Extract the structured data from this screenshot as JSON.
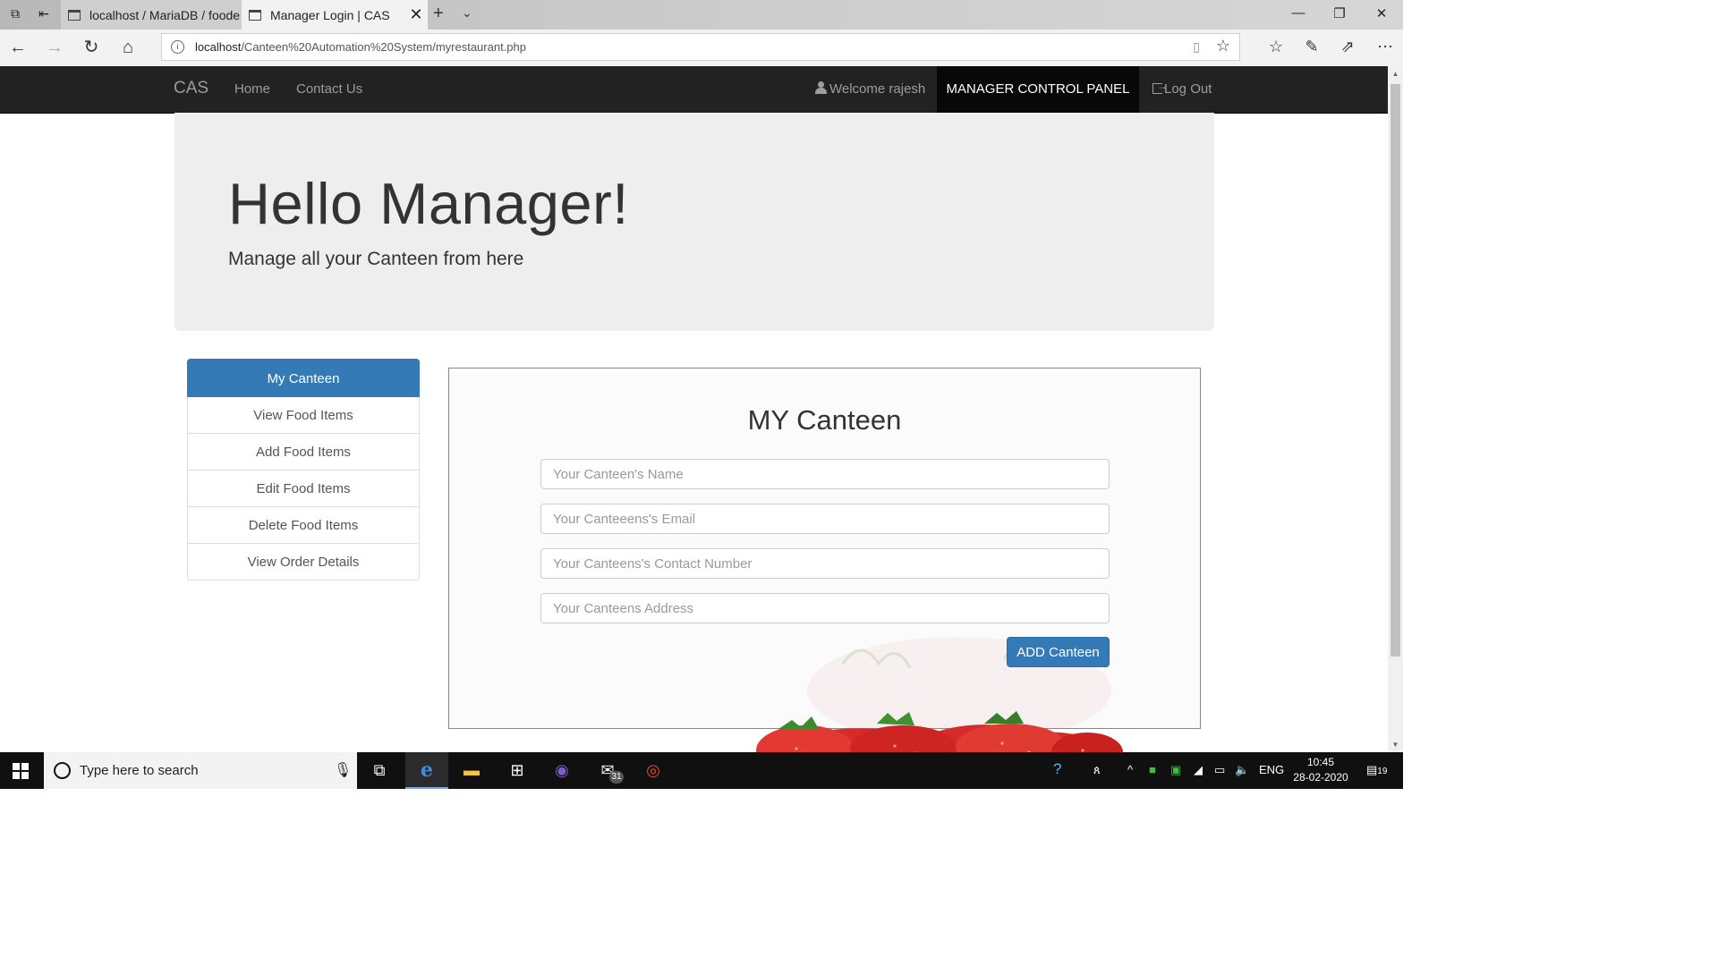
{
  "browser": {
    "tabs": [
      {
        "label": "localhost / MariaDB / foode"
      },
      {
        "label": "Manager Login | CAS"
      }
    ],
    "url_host": "localhost",
    "url_path": "/Canteen%20Automation%20System/myrestaurant.php"
  },
  "navbar": {
    "brand": "CAS",
    "links": [
      "Home",
      "Contact Us"
    ],
    "welcome": "Welcome rajesh",
    "control_panel": "MANAGER CONTROL PANEL",
    "logout": "Log Out"
  },
  "jumbotron": {
    "title": "Hello Manager!",
    "subtitle": "Manage all your Canteen from here"
  },
  "sidebar": {
    "items": [
      {
        "label": "My Canteen",
        "active": true
      },
      {
        "label": "View Food Items"
      },
      {
        "label": "Add Food Items"
      },
      {
        "label": "Edit Food Items"
      },
      {
        "label": "Delete Food Items"
      },
      {
        "label": "View Order Details"
      }
    ]
  },
  "form": {
    "title": "MY Canteen",
    "name_placeholder": "Your Canteen's Name",
    "email_placeholder": "Your Canteeens's Email",
    "contact_placeholder": "Your Canteens's Contact Number",
    "address_placeholder": "Your Canteens Address",
    "submit_label": "ADD Canteen"
  },
  "taskbar": {
    "search_placeholder": "Type here to search",
    "mail_badge": "31",
    "language": "ENG",
    "time": "10:45",
    "date": "28-02-2020",
    "notification_count": "19"
  },
  "colors": {
    "primary": "#337ab7",
    "navbar": "#222222",
    "jumbotron": "#eeeeee"
  }
}
